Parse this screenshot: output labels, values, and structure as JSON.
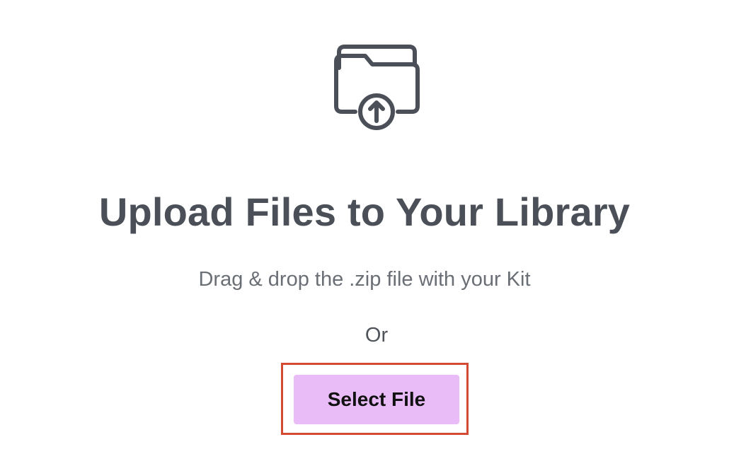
{
  "upload_panel": {
    "icon": "folder-upload-icon",
    "title": "Upload Files to Your Library",
    "subtitle": "Drag & drop the .zip file with your Kit",
    "or_label": "Or",
    "select_button_label": "Select File"
  },
  "colors": {
    "icon_stroke": "#4b5058",
    "title": "#4b5058",
    "subtitle": "#6a6e75",
    "button_background": "#e9bcf8",
    "button_text": "#111111",
    "highlight_border": "#d24a32"
  }
}
